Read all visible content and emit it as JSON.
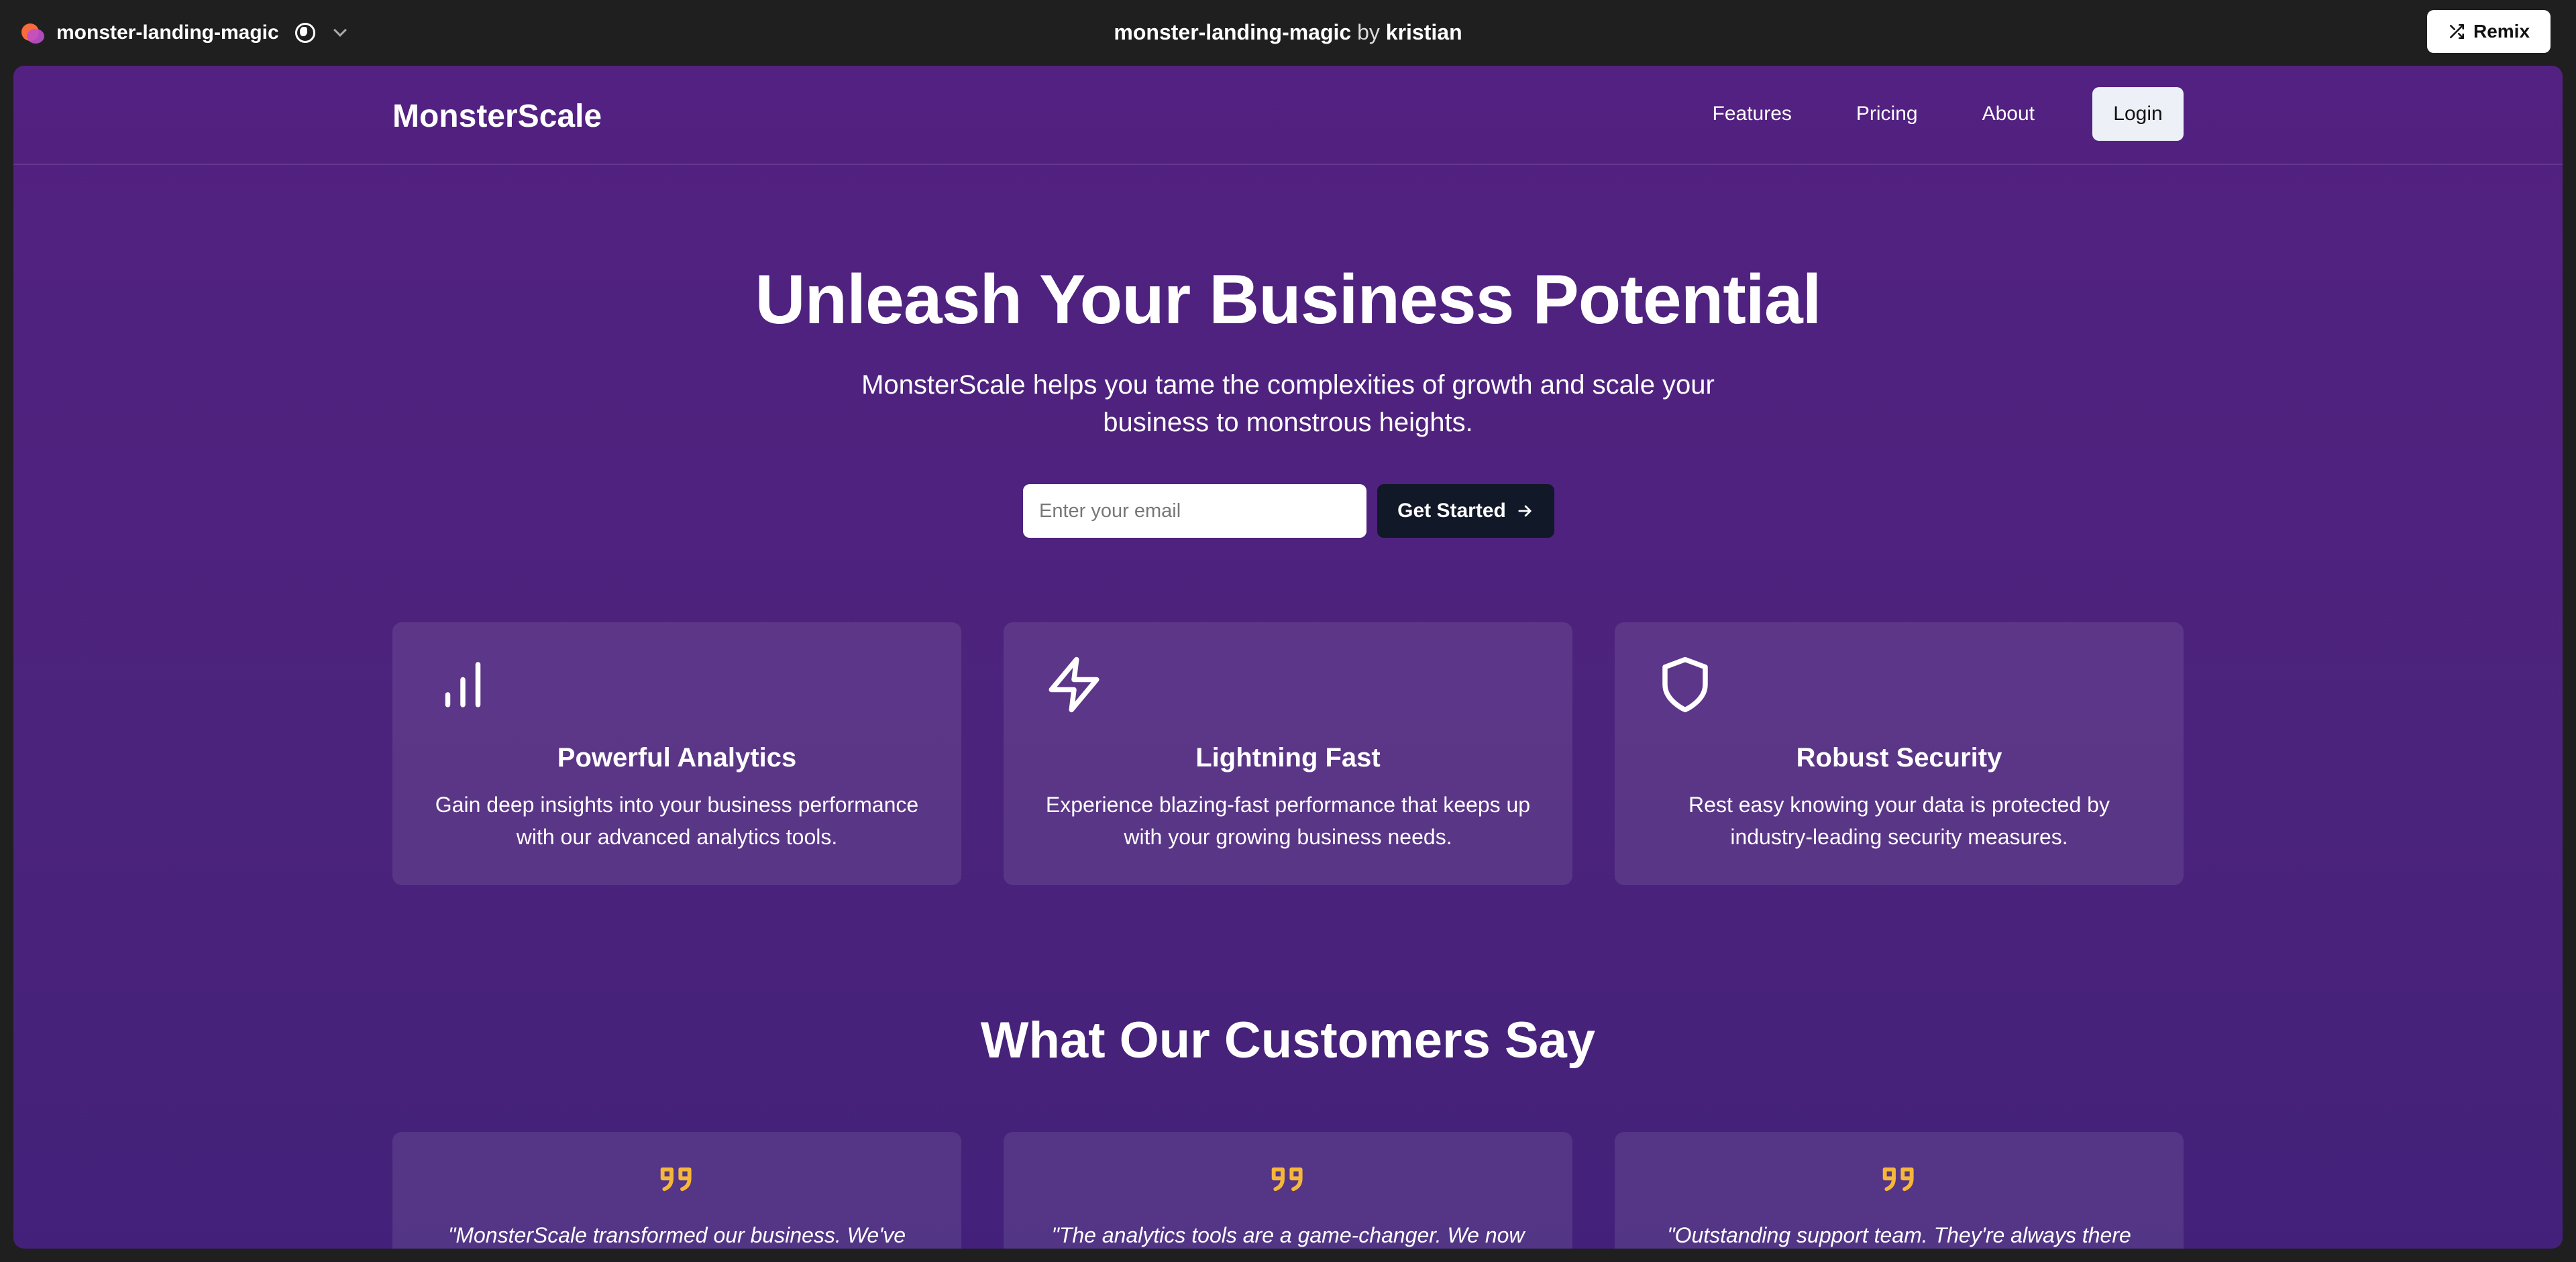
{
  "chrome": {
    "project_name": "monster-landing-magic",
    "title_project": "monster-landing-magic",
    "title_by": "by",
    "title_author": "kristian",
    "remix_label": "Remix"
  },
  "site": {
    "brand": "MonsterScale",
    "nav": {
      "features": "Features",
      "pricing": "Pricing",
      "about": "About",
      "login": "Login"
    },
    "hero": {
      "title": "Unleash Your Business Potential",
      "subtitle": "MonsterScale helps you tame the complexities of growth and scale your business to monstrous heights.",
      "email_placeholder": "Enter your email",
      "cta_label": "Get Started"
    },
    "features": [
      {
        "icon": "bar-chart-icon",
        "title": "Powerful Analytics",
        "description": "Gain deep insights into your business performance with our advanced analytics tools."
      },
      {
        "icon": "lightning-icon",
        "title": "Lightning Fast",
        "description": "Experience blazing-fast performance that keeps up with your growing business needs."
      },
      {
        "icon": "shield-icon",
        "title": "Robust Security",
        "description": "Rest easy knowing your data is protected by industry-leading security measures."
      }
    ],
    "testimonials_title": "What Our Customers Say",
    "testimonials": [
      {
        "icon": "quote-icon",
        "text": "\"MonsterScale transformed our business. We've"
      },
      {
        "icon": "quote-icon",
        "text": "\"The analytics tools are a game-changer. We now"
      },
      {
        "icon": "quote-icon",
        "text": "\"Outstanding support team. They're always there"
      }
    ]
  },
  "colors": {
    "background_top": "#532181",
    "background_bottom": "#43217a",
    "card": "#5f3a8e",
    "quote_accent": "#f5b63a",
    "cta_dark": "#111827"
  }
}
